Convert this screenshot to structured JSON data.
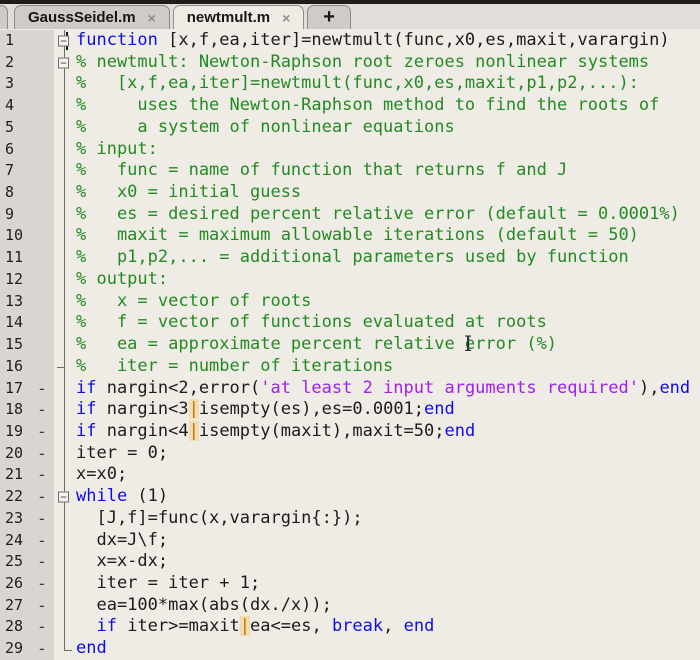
{
  "tabs": [
    {
      "label": "GaussSeidel.m",
      "close_icon": "×",
      "active": false,
      "type": "file"
    },
    {
      "label": "newtmult.m",
      "close_icon": "×",
      "active": true,
      "type": "file"
    },
    {
      "label": "+",
      "active": false,
      "type": "new"
    }
  ],
  "overlays": {
    "mouse_cursor_glyph": "I"
  },
  "colors": {
    "keyword": "#0e0ee0",
    "comment": "#228b22",
    "string": "#a020f0",
    "plain": "#1c1c1c",
    "pipe_warning_text": "#b97a00",
    "pipe_warning_bg": "#f4dcae",
    "editor_bg": "#efebe5",
    "gutter_bg": "#d9d6d1",
    "tab_inactive_bg": "#cfccc7",
    "tab_active_bg": "#efebe5"
  },
  "editor": {
    "lines": [
      {
        "n": "1",
        "bp": false,
        "fold": "box",
        "segs": [
          {
            "t": "function",
            "c": "kw"
          },
          {
            "t": " [x,f,ea,iter]=newtmult(func,x0,es,maxit,varargin)",
            "c": "txt"
          }
        ]
      },
      {
        "n": "2",
        "bp": false,
        "fold": "box",
        "segs": [
          {
            "t": "% newtmult: Newton-Raphson root zeroes nonlinear systems",
            "c": "cm"
          }
        ]
      },
      {
        "n": "3",
        "bp": false,
        "fold": "line",
        "segs": [
          {
            "t": "%   [x,f,ea,iter]=newtmult(func,x0,es,maxit,p1,p2,...):",
            "c": "cm"
          }
        ]
      },
      {
        "n": "4",
        "bp": false,
        "fold": "line",
        "segs": [
          {
            "t": "%     uses the Newton-Raphson method to find the roots of",
            "c": "cm"
          }
        ]
      },
      {
        "n": "5",
        "bp": false,
        "fold": "line",
        "segs": [
          {
            "t": "%     a system of nonlinear equations",
            "c": "cm"
          }
        ]
      },
      {
        "n": "6",
        "bp": false,
        "fold": "line",
        "segs": [
          {
            "t": "% input:",
            "c": "cm"
          }
        ]
      },
      {
        "n": "7",
        "bp": false,
        "fold": "line",
        "segs": [
          {
            "t": "%   func = name of function that returns f and J",
            "c": "cm"
          }
        ]
      },
      {
        "n": "8",
        "bp": false,
        "fold": "line",
        "segs": [
          {
            "t": "%   x0 = initial guess",
            "c": "cm"
          }
        ]
      },
      {
        "n": "9",
        "bp": false,
        "fold": "line",
        "segs": [
          {
            "t": "%   es = desired percent relative error (default = 0.0001%)",
            "c": "cm"
          }
        ]
      },
      {
        "n": "10",
        "bp": false,
        "fold": "line",
        "segs": [
          {
            "t": "%   maxit = maximum allowable iterations (default = 50)",
            "c": "cm"
          }
        ]
      },
      {
        "n": "11",
        "bp": false,
        "fold": "line",
        "segs": [
          {
            "t": "%   p1,p2,... = additional parameters used by function",
            "c": "cm"
          }
        ]
      },
      {
        "n": "12",
        "bp": false,
        "fold": "line",
        "segs": [
          {
            "t": "% output:",
            "c": "cm"
          }
        ]
      },
      {
        "n": "13",
        "bp": false,
        "fold": "line",
        "segs": [
          {
            "t": "%   x = vector of roots",
            "c": "cm"
          }
        ]
      },
      {
        "n": "14",
        "bp": false,
        "fold": "line",
        "segs": [
          {
            "t": "%   f = vector of functions evaluated at roots",
            "c": "cm"
          }
        ]
      },
      {
        "n": "15",
        "bp": false,
        "fold": "line",
        "segs": [
          {
            "t": "%   ea = approximate percent relative error (%)",
            "c": "cm"
          }
        ]
      },
      {
        "n": "16",
        "bp": false,
        "fold": "tickleft",
        "segs": [
          {
            "t": "%   iter = number of iterations",
            "c": "cm"
          }
        ]
      },
      {
        "n": "17",
        "bp": true,
        "fold": "line",
        "segs": [
          {
            "t": "if",
            "c": "kw"
          },
          {
            "t": " nargin<2,error(",
            "c": "txt"
          },
          {
            "t": "'at least 2 input arguments required'",
            "c": "str"
          },
          {
            "t": "),",
            "c": "txt"
          },
          {
            "t": "end",
            "c": "kw"
          }
        ]
      },
      {
        "n": "18",
        "bp": true,
        "fold": "line",
        "segs": [
          {
            "t": "if",
            "c": "kw"
          },
          {
            "t": " nargin<3",
            "c": "txt"
          },
          {
            "t": "|",
            "c": "pipe"
          },
          {
            "t": "isempty(es),es=0.0001;",
            "c": "txt"
          },
          {
            "t": "end",
            "c": "kw"
          }
        ]
      },
      {
        "n": "19",
        "bp": true,
        "fold": "line",
        "segs": [
          {
            "t": "if",
            "c": "kw"
          },
          {
            "t": " nargin<4",
            "c": "txt"
          },
          {
            "t": "|",
            "c": "pipe"
          },
          {
            "t": "isempty(maxit),maxit=50;",
            "c": "txt"
          },
          {
            "t": "end",
            "c": "kw"
          }
        ]
      },
      {
        "n": "20",
        "bp": true,
        "fold": "line",
        "segs": [
          {
            "t": "iter = 0;",
            "c": "txt"
          }
        ]
      },
      {
        "n": "21",
        "bp": true,
        "fold": "line",
        "segs": [
          {
            "t": "x=x0;",
            "c": "txt"
          }
        ]
      },
      {
        "n": "22",
        "bp": true,
        "fold": "box",
        "segs": [
          {
            "t": "while",
            "c": "kw"
          },
          {
            "t": " (1)",
            "c": "txt"
          }
        ]
      },
      {
        "n": "23",
        "bp": true,
        "fold": "line",
        "segs": [
          {
            "t": "  [J,f]=func(x,varargin{:});",
            "c": "txt"
          }
        ]
      },
      {
        "n": "24",
        "bp": true,
        "fold": "line",
        "segs": [
          {
            "t": "  dx=J\\f;",
            "c": "txt"
          }
        ]
      },
      {
        "n": "25",
        "bp": true,
        "fold": "line",
        "segs": [
          {
            "t": "  x=x-dx;",
            "c": "txt"
          }
        ]
      },
      {
        "n": "26",
        "bp": true,
        "fold": "line",
        "segs": [
          {
            "t": "  iter = iter + 1;",
            "c": "txt"
          }
        ]
      },
      {
        "n": "27",
        "bp": true,
        "fold": "line",
        "segs": [
          {
            "t": "  ea=100*max(abs(dx./x));",
            "c": "txt"
          }
        ]
      },
      {
        "n": "28",
        "bp": true,
        "fold": "line",
        "segs": [
          {
            "t": "  ",
            "c": "txt"
          },
          {
            "t": "if",
            "c": "kw"
          },
          {
            "t": " iter>=maxit",
            "c": "txt"
          },
          {
            "t": "|",
            "c": "pipe"
          },
          {
            "t": "ea<=es, ",
            "c": "txt"
          },
          {
            "t": "break",
            "c": "kw"
          },
          {
            "t": ", ",
            "c": "txt"
          },
          {
            "t": "end",
            "c": "kw"
          }
        ]
      },
      {
        "n": "29",
        "bp": true,
        "fold": "corner",
        "segs": [
          {
            "t": "end",
            "c": "kw"
          }
        ]
      }
    ]
  }
}
